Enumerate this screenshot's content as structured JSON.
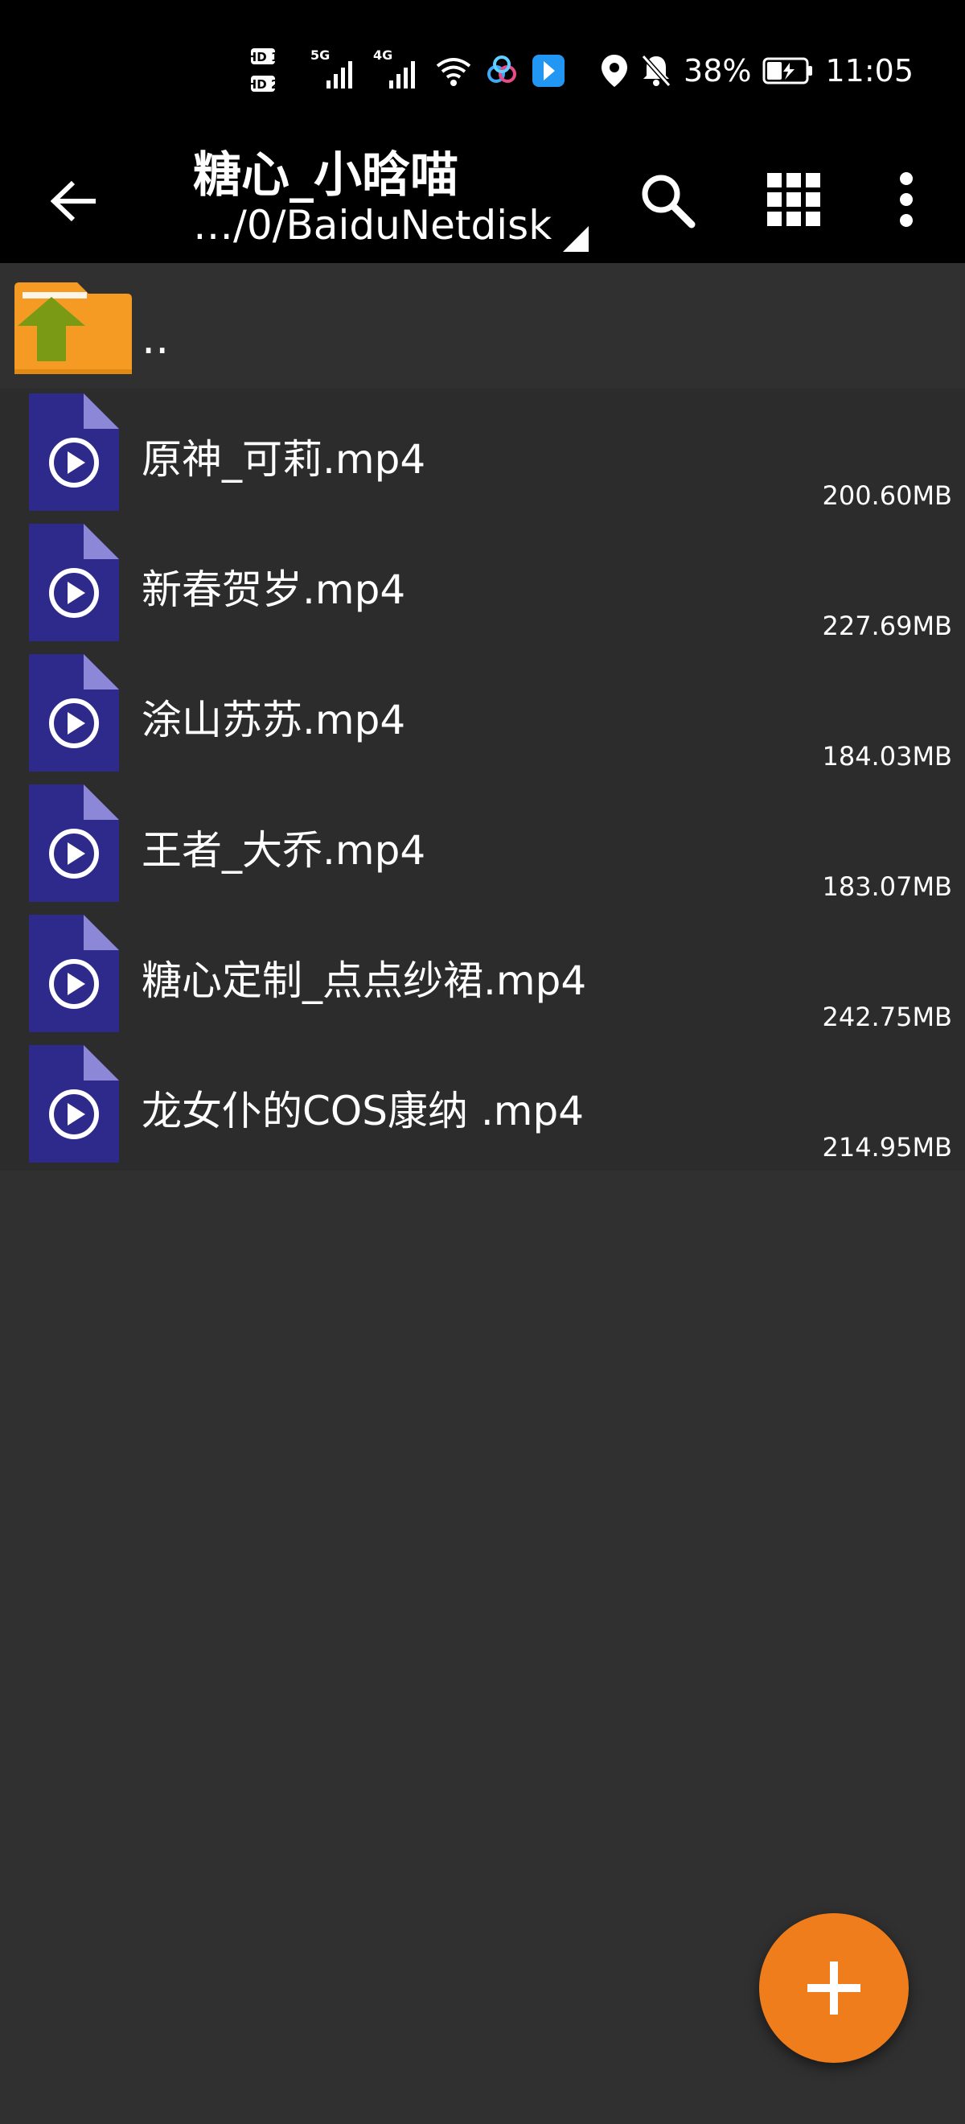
{
  "status_bar": {
    "network_labels": [
      "HD 1",
      "HD 2",
      "5G",
      "4G"
    ],
    "battery": "38%",
    "time": "11:05"
  },
  "toolbar": {
    "title": "糖心_小晗喵",
    "path": "…/0/BaiduNetdisk",
    "icons": [
      "back-arrow-icon",
      "search-icon",
      "grid-view-icon",
      "more-vert-icon"
    ]
  },
  "parent_item": {
    "label": ".."
  },
  "files": [
    {
      "name": "原神_可莉.mp4",
      "size": "200.60MB"
    },
    {
      "name": "新春贺岁.mp4",
      "size": "227.69MB"
    },
    {
      "name": "涂山苏苏.mp4",
      "size": "184.03MB"
    },
    {
      "name": "王者_大乔.mp4",
      "size": "183.07MB"
    },
    {
      "name": "糖心定制_点点纱裙.mp4",
      "size": "242.75MB"
    },
    {
      "name": "龙女仆的COS康纳 .mp4",
      "size": "214.95MB"
    }
  ],
  "colors": {
    "bar": "#000000",
    "background": "#303030",
    "row": "#2c2c2c",
    "file_icon": "#2e2a8c",
    "fab": "#f07d1c",
    "folder": "#f59a23",
    "folder_arrow": "#7a9a16"
  }
}
